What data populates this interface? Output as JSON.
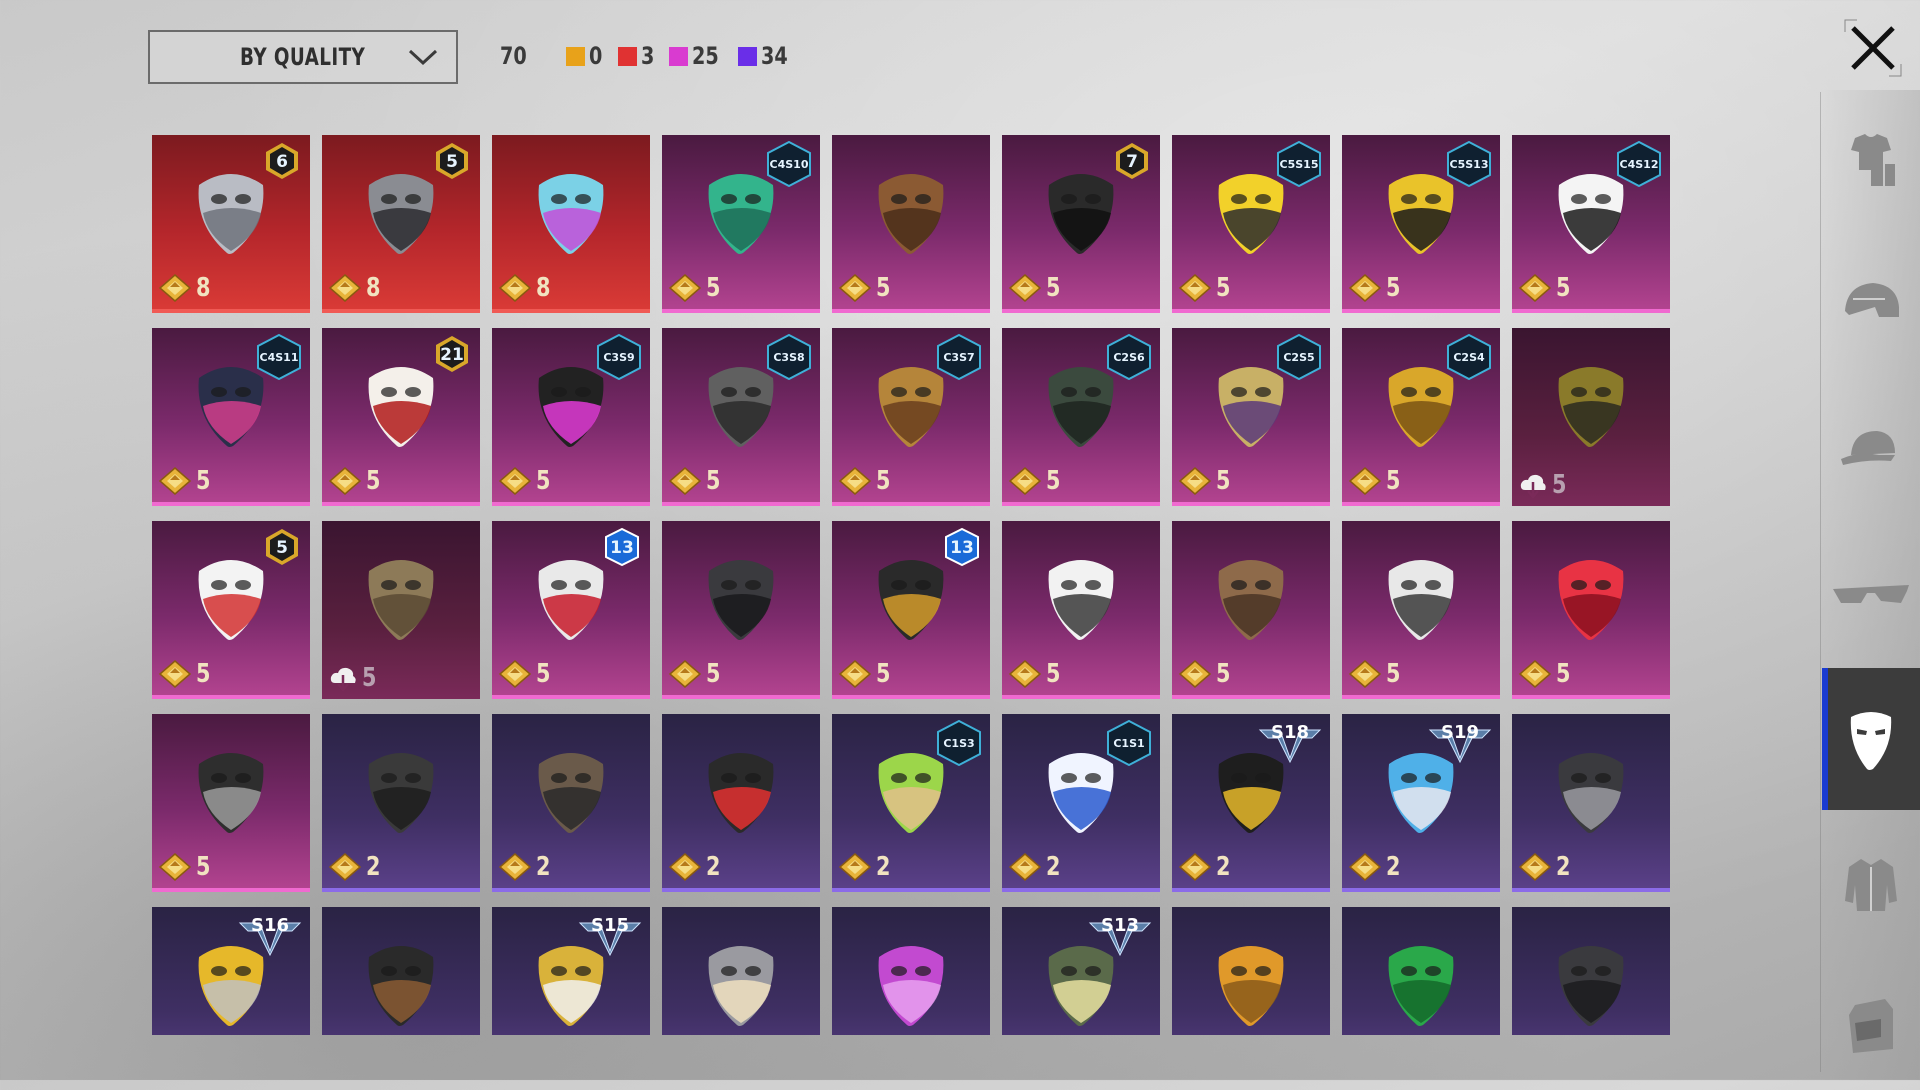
{
  "toolbar": {
    "sort_label": "BY QUALITY",
    "total": "70",
    "counts": [
      {
        "color": "#e8a21a",
        "value": "0"
      },
      {
        "color": "#e03232",
        "value": "3"
      },
      {
        "color": "#d93bd0",
        "value": "25"
      },
      {
        "color": "#6a2ee8",
        "value": "34"
      }
    ]
  },
  "categories": [
    {
      "name": "outfit",
      "active": false
    },
    {
      "name": "helmet",
      "active": false
    },
    {
      "name": "cap",
      "active": false
    },
    {
      "name": "glasses",
      "active": false
    },
    {
      "name": "mask",
      "active": true
    },
    {
      "name": "jacket",
      "active": false
    },
    {
      "name": "backpack",
      "active": false
    }
  ],
  "items": [
    {
      "quality": "red",
      "cost": "8",
      "badge": "6",
      "badge_type": "num",
      "icon": "plague-mask"
    },
    {
      "quality": "red",
      "cost": "8",
      "badge": "5",
      "badge_type": "num",
      "icon": "tech-gas-mask"
    },
    {
      "quality": "red",
      "cost": "8",
      "badge": "",
      "badge_type": "",
      "icon": "rainbow-helmet-mask"
    },
    {
      "quality": "pink",
      "cost": "5",
      "badge": "C4S10",
      "badge_type": "season",
      "icon": "green-visor"
    },
    {
      "quality": "pink",
      "cost": "5",
      "badge": "",
      "badge_type": "",
      "icon": "brown-bandana"
    },
    {
      "quality": "pink",
      "cost": "5",
      "badge": "7",
      "badge_type": "num",
      "icon": "wire-earpiece"
    },
    {
      "quality": "pink",
      "cost": "5",
      "badge": "C5S15",
      "badge_type": "season",
      "icon": "yellow-respirator"
    },
    {
      "quality": "pink",
      "cost": "5",
      "badge": "C5S13",
      "badge_type": "season",
      "icon": "graffiti-mask"
    },
    {
      "quality": "pink",
      "cost": "5",
      "badge": "C4S12",
      "badge_type": "season",
      "icon": "teeth-mask"
    },
    {
      "quality": "pink",
      "cost": "5",
      "badge": "C4S11",
      "badge_type": "season",
      "icon": "cyber-mask"
    },
    {
      "quality": "pink",
      "cost": "5",
      "badge": "21",
      "badge_type": "num",
      "icon": "clown-grin-mask"
    },
    {
      "quality": "pink",
      "cost": "5",
      "badge": "C3S9",
      "badge_type": "season",
      "icon": "neon-respirator"
    },
    {
      "quality": "pink",
      "cost": "5",
      "badge": "C3S8",
      "badge_type": "season",
      "icon": "grey-respirator"
    },
    {
      "quality": "pink",
      "cost": "5",
      "badge": "C3S7",
      "badge_type": "season",
      "icon": "gold-veil-mask"
    },
    {
      "quality": "pink",
      "cost": "5",
      "badge": "C2S6",
      "badge_type": "season",
      "icon": "camo-mask"
    },
    {
      "quality": "pink",
      "cost": "5",
      "badge": "C2S5",
      "badge_type": "season",
      "icon": "patch-mask"
    },
    {
      "quality": "pink",
      "cost": "5",
      "badge": "C2S4",
      "badge_type": "season",
      "icon": "gold-skull-mask"
    },
    {
      "quality": "dark",
      "cost": "5",
      "badge": "",
      "badge_type": "download",
      "icon": "gold-helmet-mask"
    },
    {
      "quality": "pink",
      "cost": "5",
      "badge": "5",
      "badge_type": "num",
      "icon": "clown-face"
    },
    {
      "quality": "dark",
      "cost": "5",
      "badge": "",
      "badge_type": "download",
      "icon": "laurel-mask"
    },
    {
      "quality": "pink",
      "cost": "5",
      "badge": "13",
      "badge_type": "num13",
      "icon": "red-white-mask"
    },
    {
      "quality": "pink",
      "cost": "5",
      "badge": "",
      "badge_type": "",
      "icon": "black-neck-mask"
    },
    {
      "quality": "pink",
      "cost": "5",
      "badge": "13",
      "badge_type": "num13",
      "icon": "gold-respirator"
    },
    {
      "quality": "pink",
      "cost": "5",
      "badge": "",
      "badge_type": "",
      "icon": "white-cloth-mask"
    },
    {
      "quality": "pink",
      "cost": "5",
      "badge": "",
      "badge_type": "",
      "icon": "beak-mask"
    },
    {
      "quality": "pink",
      "cost": "5",
      "badge": "",
      "badge_type": "",
      "icon": "hooded-skull-mask"
    },
    {
      "quality": "pink",
      "cost": "5",
      "badge": "",
      "badge_type": "",
      "icon": "red-nose"
    },
    {
      "quality": "pink",
      "cost": "5",
      "badge": "",
      "badge_type": "",
      "icon": "skull-bandana"
    },
    {
      "quality": "purple",
      "cost": "2",
      "badge": "",
      "badge_type": "",
      "icon": "black-mask"
    },
    {
      "quality": "purple",
      "cost": "2",
      "badge": "",
      "badge_type": "",
      "icon": "armored-mask"
    },
    {
      "quality": "purple",
      "cost": "2",
      "badge": "",
      "badge_type": "",
      "icon": "red-lens-mask"
    },
    {
      "quality": "purple",
      "cost": "2",
      "badge": "C1S3",
      "badge_type": "season",
      "icon": "cactus-bandana"
    },
    {
      "quality": "purple",
      "cost": "2",
      "badge": "C1S1",
      "badge_type": "season",
      "icon": "blue-medical-mask"
    },
    {
      "quality": "purple",
      "cost": "2",
      "badge": "S18",
      "badge_type": "wing",
      "icon": "heartbeat-mask"
    },
    {
      "quality": "purple",
      "cost": "2",
      "badge": "S19",
      "badge_type": "wing",
      "icon": "goggles-mask"
    },
    {
      "quality": "purple",
      "cost": "2",
      "badge": "",
      "badge_type": "",
      "icon": "skull-medical-mask"
    },
    {
      "quality": "purple",
      "cost": "",
      "badge": "S16",
      "badge_type": "wing",
      "icon": "yellow-visor-mask"
    },
    {
      "quality": "purple",
      "cost": "",
      "badge": "",
      "badge_type": "",
      "icon": "dark-bandana"
    },
    {
      "quality": "purple",
      "cost": "",
      "badge": "S15",
      "badge_type": "wing",
      "icon": "horned-gold-mask"
    },
    {
      "quality": "purple",
      "cost": "",
      "badge": "",
      "badge_type": "",
      "icon": "silver-eye-mask"
    },
    {
      "quality": "purple",
      "cost": "",
      "badge": "",
      "badge_type": "",
      "icon": "purple-gas-mask"
    },
    {
      "quality": "purple",
      "cost": "",
      "badge": "S13",
      "badge_type": "wing",
      "icon": "green-goggle-helmet"
    },
    {
      "quality": "purple",
      "cost": "",
      "badge": "",
      "badge_type": "",
      "icon": "orange-neck-gaiter"
    },
    {
      "quality": "purple",
      "cost": "",
      "badge": "",
      "badge_type": "",
      "icon": "green-neck-gaiter"
    },
    {
      "quality": "purple",
      "cost": "",
      "badge": "",
      "badge_type": "",
      "icon": "black-neck-gaiter"
    }
  ]
}
